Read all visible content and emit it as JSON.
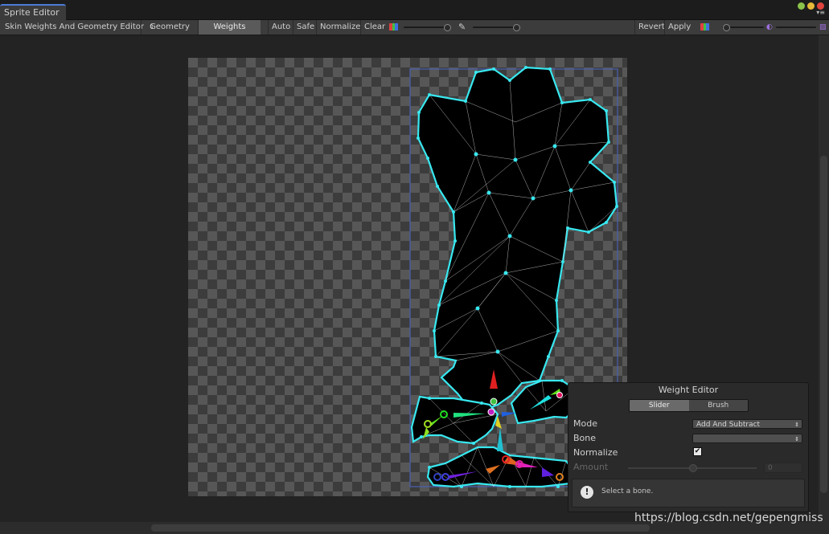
{
  "window": {
    "tab_title": "Sprite Editor",
    "buttons": [
      {
        "name": "minimize",
        "color": "#8bc34a"
      },
      {
        "name": "maximize",
        "color": "#e8b938"
      },
      {
        "name": "close",
        "color": "#e0443e"
      }
    ]
  },
  "toolbar": {
    "mode_dropdown": "Skin Weights And Geometry Editor",
    "geometry_tab": "Geometry",
    "weights_tab": "Weights",
    "auto_label": "Auto",
    "safe_label": "Safe",
    "normalize_label": "Normalize",
    "clear_label": "Clear",
    "revert_label": "Revert",
    "apply_label": "Apply",
    "color_icon": "rgb-channels-icon",
    "brush_icon": "brush-icon"
  },
  "weight_editor": {
    "title": "Weight Editor",
    "mode_tabs": [
      "Slider",
      "Brush"
    ],
    "active_tab": "Slider",
    "mode_label": "Mode",
    "mode_value": "Add And Subtract",
    "bone_label": "Bone",
    "bone_value": "",
    "normalize_label": "Normalize",
    "normalize_checked": true,
    "amount_label": "Amount",
    "amount_value": "0",
    "help_text": "Select a bone."
  },
  "watermark": "https://blog.csdn.net/gepengmiss",
  "colors": {
    "mesh_outline": "#38e8f0",
    "selection_rect": "#4a5fb0",
    "tab_accent": "#4b7bd8"
  }
}
